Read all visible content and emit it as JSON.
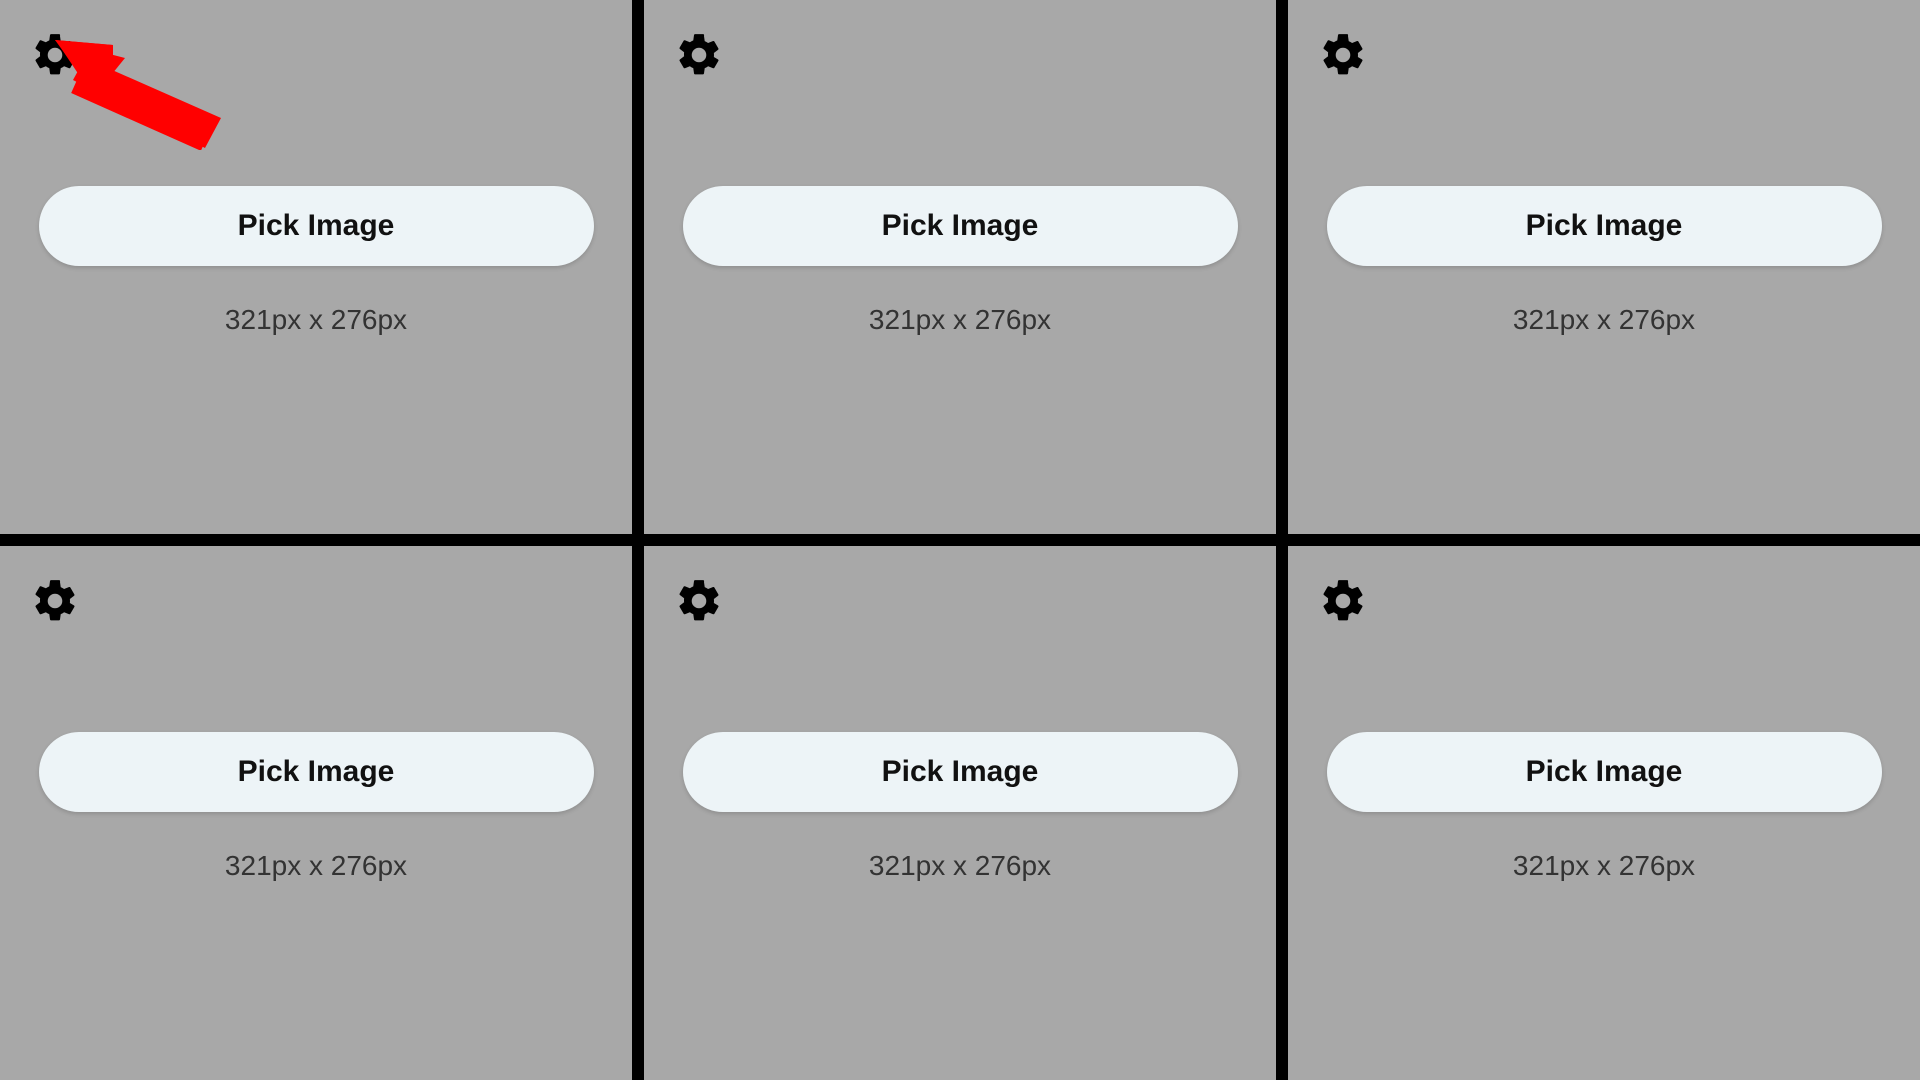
{
  "cells": [
    {
      "button_label": "Pick Image",
      "dimensions": "321px x 276px"
    },
    {
      "button_label": "Pick Image",
      "dimensions": "321px x 276px"
    },
    {
      "button_label": "Pick Image",
      "dimensions": "321px x 276px"
    },
    {
      "button_label": "Pick Image",
      "dimensions": "321px x 276px"
    },
    {
      "button_label": "Pick Image",
      "dimensions": "321px x 276px"
    },
    {
      "button_label": "Pick Image",
      "dimensions": "321px x 276px"
    }
  ],
  "annotation": {
    "arrow_color": "#ff0000"
  }
}
